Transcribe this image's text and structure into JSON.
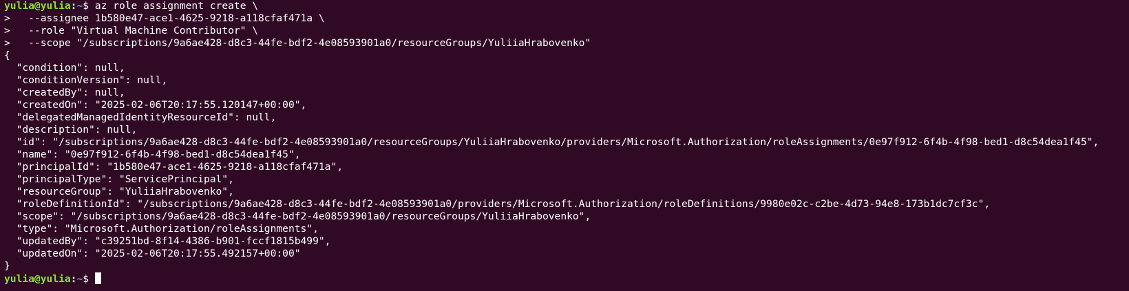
{
  "prompt": {
    "user_host": "yulia@yulia",
    "colon": ":",
    "cwd": "~",
    "symbol": "$ "
  },
  "command_lines": [
    "az role assignment create \\",
    ">   --assignee 1b580e47-ace1-4625-9218-a118cfaf471a \\",
    ">   --role \"Virtual Machine Contributor\" \\",
    ">   --scope \"/subscriptions/9a6ae428-d8c3-44fe-bdf2-4e08593901a0/resourceGroups/YuliiaHrabovenko\""
  ],
  "output_lines": [
    "{",
    "  \"condition\": null,",
    "  \"conditionVersion\": null,",
    "  \"createdBy\": null,",
    "  \"createdOn\": \"2025-02-06T20:17:55.120147+00:00\",",
    "  \"delegatedManagedIdentityResourceId\": null,",
    "  \"description\": null,",
    "  \"id\": \"/subscriptions/9a6ae428-d8c3-44fe-bdf2-4e08593901a0/resourceGroups/YuliiaHrabovenko/providers/Microsoft.Authorization/roleAssignments/0e97f912-6f4b-4f98-bed1-d8c54dea1f45\",",
    "  \"name\": \"0e97f912-6f4b-4f98-bed1-d8c54dea1f45\",",
    "  \"principalId\": \"1b580e47-ace1-4625-9218-a118cfaf471a\",",
    "  \"principalType\": \"ServicePrincipal\",",
    "  \"resourceGroup\": \"YuliiaHrabovenko\",",
    "  \"roleDefinitionId\": \"/subscriptions/9a6ae428-d8c3-44fe-bdf2-4e08593901a0/providers/Microsoft.Authorization/roleDefinitions/9980e02c-c2be-4d73-94e8-173b1dc7cf3c\",",
    "  \"scope\": \"/subscriptions/9a6ae428-d8c3-44fe-bdf2-4e08593901a0/resourceGroups/YuliiaHrabovenko\",",
    "  \"type\": \"Microsoft.Authorization/roleAssignments\",",
    "  \"updatedBy\": \"c39251bd-8f14-4386-b901-fccf1815b499\",",
    "  \"updatedOn\": \"2025-02-06T20:17:55.492157+00:00\"",
    "}"
  ],
  "colors": {
    "background": "#300a24",
    "text": "#ffffff",
    "user_host": "#8ae234",
    "cwd": "#729fcf"
  }
}
